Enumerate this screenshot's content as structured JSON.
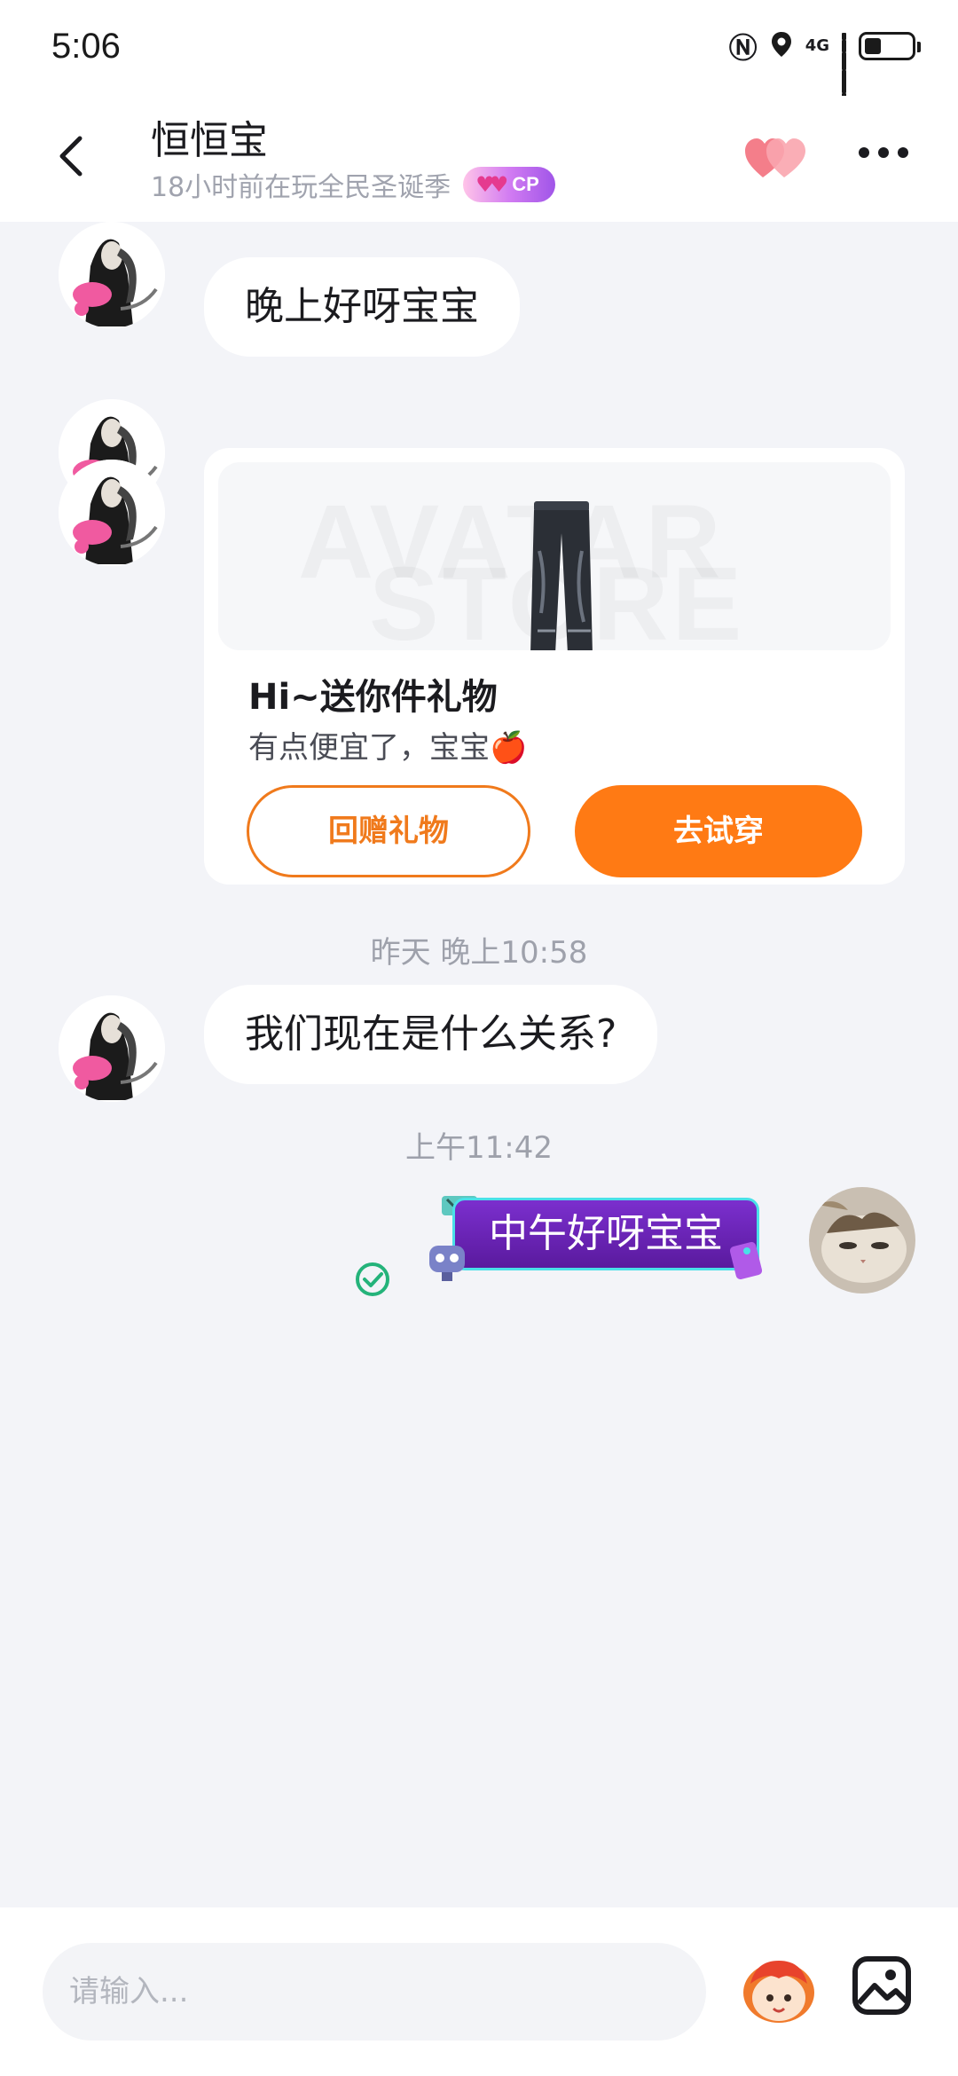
{
  "status_bar": {
    "time": "5:06",
    "network": "4G"
  },
  "header": {
    "name": "恒恒宝",
    "status": "18小时前在玩全民圣诞季",
    "badge": "CP"
  },
  "messages": {
    "m1": "晚上好呀宝宝",
    "gift_card": {
      "title": "Hi~送你件礼物",
      "desc": "有点便宜了，宝宝🍎",
      "watermark_top": "AVATAR",
      "watermark_bottom": "STORE",
      "return_gift_button": "回赠礼物",
      "try_on_button": "去试穿"
    },
    "ts1": "昨天 晚上10:58",
    "m2": "我们现在是什么关系?",
    "ts2": "上午11:42",
    "m3": "中午好呀宝宝"
  },
  "input": {
    "placeholder": "请输入..."
  },
  "colors": {
    "accent": "#FF7A14",
    "bubble_purple": "#6A24B8",
    "background": "#F3F4F8"
  }
}
